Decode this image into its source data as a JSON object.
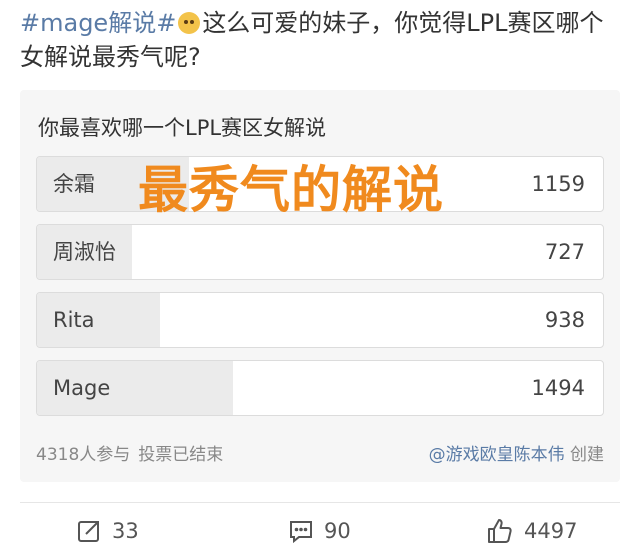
{
  "post": {
    "hashtag": "#mage解说#",
    "emoji_icon": "dog-face-icon",
    "text": "这么可爱的妹子，你觉得LPL赛区哪个女解说最秀气呢?"
  },
  "poll": {
    "question": "你最喜欢哪一个LPL赛区女解说",
    "options": [
      {
        "label": "余霜",
        "count": "1159",
        "share": 0.268
      },
      {
        "label": "周淑怡",
        "count": "727",
        "share": 0.168
      },
      {
        "label": "Rita",
        "count": "938",
        "share": 0.217
      },
      {
        "label": "Mage",
        "count": "1494",
        "share": 0.346
      }
    ],
    "participants": "4318人参与",
    "status": "投票已结束",
    "creator": "@游戏欧皇陈本伟",
    "created_label": "创建"
  },
  "overlay_caption": "最秀气的解说",
  "actions": {
    "repost_count": "33",
    "comment_count": "90",
    "like_count": "4497"
  },
  "colors": {
    "link": "#5a7ba6",
    "caption": "#f08a1e",
    "bar_fill": "#ebebeb"
  }
}
